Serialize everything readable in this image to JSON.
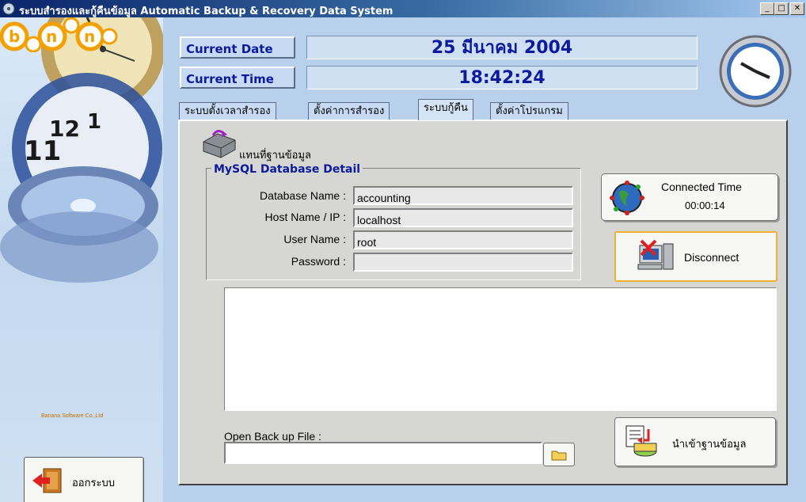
{
  "window": {
    "title": "ระบบสำรองและกู้คืนข้อมูล  Automatic Backup & Recovery Data System",
    "controls": {
      "minimize": "_",
      "maximize": "□",
      "close": "✕"
    }
  },
  "brand": {
    "subtitle": "Banana Software Co.,Ltd"
  },
  "header": {
    "date_label": "Current Date",
    "date_value": "25 มีนาคม 2004",
    "time_label": "Current Time",
    "time_value": "18:42:24"
  },
  "tabs": [
    {
      "label": "ระบบตั้งเวลาสำรอง",
      "active": false
    },
    {
      "label": "ตั้งค่าการสำรอง",
      "active": false
    },
    {
      "label": "ระบบกู้คืน",
      "active": true
    },
    {
      "label": "ตั้งค่าโปรแกรม",
      "active": false
    }
  ],
  "panel": {
    "title": "แทนที่ฐานข้อมูล",
    "group_title": "MySQL Database Detail",
    "fields": [
      {
        "label": "Database Name :",
        "value": "accounting"
      },
      {
        "label": "Host Name / IP :",
        "value": "localhost"
      },
      {
        "label": "User Name :",
        "value": "root"
      },
      {
        "label": "Password :",
        "value": ""
      }
    ],
    "connected": {
      "title": "Connected Time",
      "value": "00:00:14"
    },
    "disconnect_label": "Disconnect",
    "log_text": "",
    "open_file_label": "Open Back up File :",
    "file_path": "",
    "import_label": "นำเข้าฐานข้อมูล"
  },
  "exit_label": "ออกระบบ",
  "icons": {
    "app": "disk-icon",
    "clock": "clock-icon",
    "database": "database-icon",
    "globe": "globe-icon",
    "disconnect": "computer-disconnect-icon",
    "folder": "folder-icon",
    "import": "import-icon",
    "exit": "exit-door-icon"
  }
}
